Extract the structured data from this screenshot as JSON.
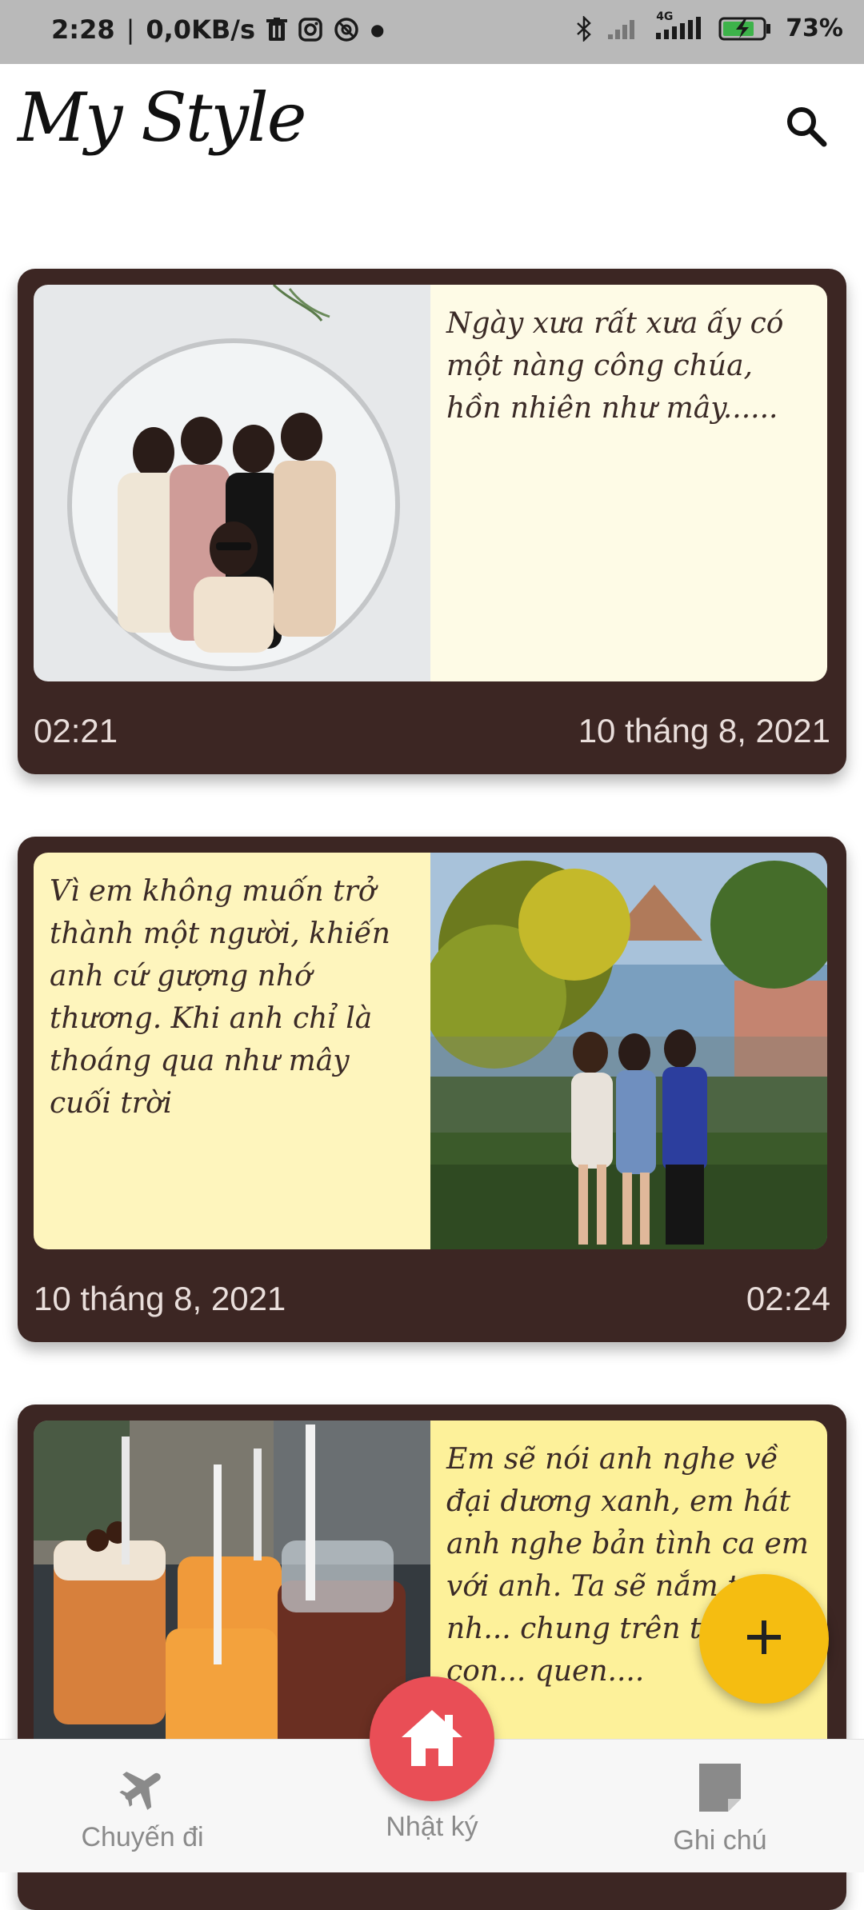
{
  "status_bar": {
    "time": "2:28",
    "speed": "0,0KB/s",
    "network": "4G",
    "battery": "73%",
    "icons": [
      "trash-icon",
      "instagram-icon",
      "sync-icon",
      "bluetooth-icon",
      "signal-icon",
      "battery-icon"
    ]
  },
  "app": {
    "title": "My Style",
    "search_icon": "search-icon"
  },
  "entries": [
    {
      "note": "Ngày xưa rất xưa ấy có một nàng công chúa, hồn nhiên như mây......",
      "time": "02:21",
      "date": "10 tháng 8, 2021",
      "photo": "group-of-five-friends-photo",
      "note_color": "#fefbe6"
    },
    {
      "note": "Vì em không muốn trở thành một người, khiến anh cứ gượng nhớ thương. Khi anh chỉ là thoáng qua như mây cuối trời",
      "date": "10 tháng 8, 2021",
      "time": "02:24",
      "photo": "three-women-garden-photo",
      "note_color": "#fef5bd"
    },
    {
      "note": "Em sẽ nói anh nghe về đại dương xanh, em hát anh nghe bản tình ca em với anh. Ta sẽ nắm tay nh... chung trên từng con... quen....",
      "photo": "drinks-on-table-photo",
      "note_color": "#fdf19a"
    }
  ],
  "fab": {
    "icon": "plus-icon",
    "color": "#f5bd11"
  },
  "bottom_nav": {
    "items": [
      {
        "label": "Chuyến đi",
        "icon": "airplane-icon"
      },
      {
        "label": "Nhật ký",
        "icon": "home-icon"
      },
      {
        "label": "Ghi chú",
        "icon": "note-icon"
      }
    ],
    "home_color": "#e94e56"
  },
  "colors": {
    "card": "#3c2623",
    "status_bar": "#b9b9b9"
  }
}
